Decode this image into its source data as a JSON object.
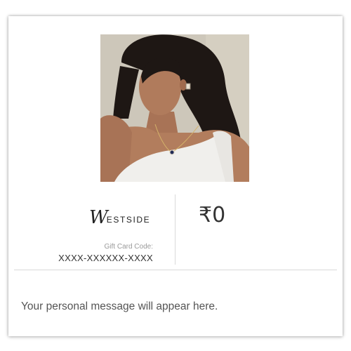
{
  "gift_card": {
    "brand_logo_text": "ESTSIDE",
    "brand_logo_initial": "W",
    "brand_name": "WESTSIDE",
    "code_label": "Gift Card Code:",
    "code_value": "XXXX-XXXXXX-XXXX",
    "currency_symbol": "₹",
    "amount": "0",
    "personal_message": "Your personal message will appear here.",
    "photo": "model-wearing-pendant-necklace-and-earrings"
  },
  "colors": {
    "card_bg": "#ffffff",
    "divider": "#d9d9d9",
    "text_dark": "#333333",
    "text_muted": "#9a9a9a",
    "message_text": "#555555"
  }
}
